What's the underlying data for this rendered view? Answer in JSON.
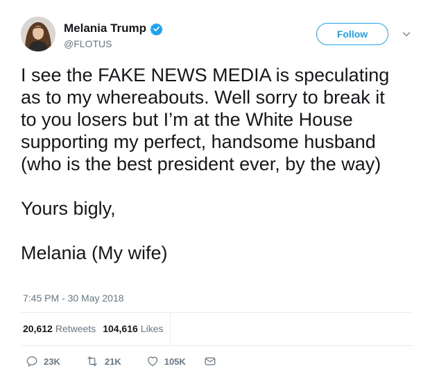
{
  "author": {
    "display_name": "Melania Trump",
    "handle": "@FLOTUS",
    "verified": true
  },
  "follow_button": {
    "label": "Follow"
  },
  "tweet": {
    "lines_paragraph_1": "I see the FAKE NEWS MEDIA is speculating\nas to my whereabouts. Well sorry to break it\nto you losers but I’m at the White House\nsupporting my perfect, handsome husband\n(who is the best president ever, by the way)",
    "paragraph_2": "Yours bigly,",
    "paragraph_3": "Melania (My wife)",
    "timestamp": "7:45 PM - 30 May 2018"
  },
  "stats": {
    "retweets_count": "20,612",
    "retweets_label": "Retweets",
    "likes_count": "104,616",
    "likes_label": "Likes"
  },
  "actions": {
    "reply_count": "23K",
    "retweet_count": "21K",
    "like_count": "105K"
  },
  "colors": {
    "accent": "#1da1f2",
    "text": "#14171a",
    "muted": "#657786",
    "divider": "#e6ecf0"
  },
  "icons": [
    "verified-badge-icon",
    "chevron-down-icon",
    "reply-icon",
    "retweet-icon",
    "heart-icon",
    "message-icon"
  ]
}
